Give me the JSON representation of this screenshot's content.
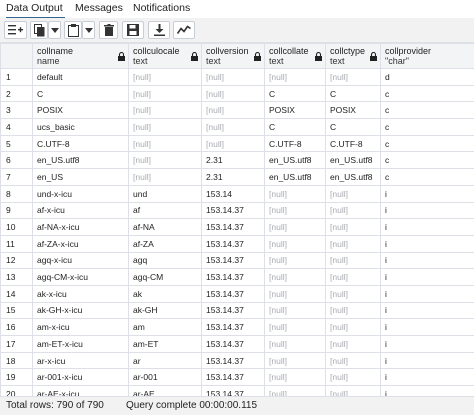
{
  "tabs": [
    {
      "label": "Data Output",
      "active": true
    },
    {
      "label": "Messages",
      "active": false
    },
    {
      "label": "Notifications",
      "active": false
    }
  ],
  "toolbar": {
    "buttons": [
      "add-row-icon",
      "copy-icon",
      "copy-dropdown-icon",
      "paste-icon",
      "paste-dropdown-icon",
      "delete-icon",
      "save-data-icon",
      "download-icon",
      "graph-icon"
    ]
  },
  "columns": [
    {
      "name": "",
      "type": ""
    },
    {
      "name": "collname",
      "type": "name"
    },
    {
      "name": "collculocale",
      "type": "text"
    },
    {
      "name": "collversion",
      "type": "text"
    },
    {
      "name": "collcollate",
      "type": "text"
    },
    {
      "name": "collctype",
      "type": "text"
    },
    {
      "name": "collprovider",
      "type": "\"char\""
    }
  ],
  "null_text": "[null]",
  "rows": [
    [
      "1",
      "default",
      "[null]",
      "[null]",
      "[null]",
      "[null]",
      "d"
    ],
    [
      "2",
      "C",
      "[null]",
      "[null]",
      "C",
      "C",
      "c"
    ],
    [
      "3",
      "POSIX",
      "[null]",
      "[null]",
      "POSIX",
      "POSIX",
      "c"
    ],
    [
      "4",
      "ucs_basic",
      "[null]",
      "[null]",
      "C",
      "C",
      "c"
    ],
    [
      "5",
      "C.UTF-8",
      "[null]",
      "[null]",
      "C.UTF-8",
      "C.UTF-8",
      "c"
    ],
    [
      "6",
      "en_US.utf8",
      "[null]",
      "2.31",
      "en_US.utf8",
      "en_US.utf8",
      "c"
    ],
    [
      "7",
      "en_US",
      "[null]",
      "2.31",
      "en_US.utf8",
      "en_US.utf8",
      "c"
    ],
    [
      "8",
      "und-x-icu",
      "und",
      "153.14",
      "[null]",
      "[null]",
      "i"
    ],
    [
      "9",
      "af-x-icu",
      "af",
      "153.14.37",
      "[null]",
      "[null]",
      "i"
    ],
    [
      "10",
      "af-NA-x-icu",
      "af-NA",
      "153.14.37",
      "[null]",
      "[null]",
      "i"
    ],
    [
      "11",
      "af-ZA-x-icu",
      "af-ZA",
      "153.14.37",
      "[null]",
      "[null]",
      "i"
    ],
    [
      "12",
      "agq-x-icu",
      "agq",
      "153.14.37",
      "[null]",
      "[null]",
      "i"
    ],
    [
      "13",
      "agq-CM-x-icu",
      "agq-CM",
      "153.14.37",
      "[null]",
      "[null]",
      "i"
    ],
    [
      "14",
      "ak-x-icu",
      "ak",
      "153.14.37",
      "[null]",
      "[null]",
      "i"
    ],
    [
      "15",
      "ak-GH-x-icu",
      "ak-GH",
      "153.14.37",
      "[null]",
      "[null]",
      "i"
    ],
    [
      "16",
      "am-x-icu",
      "am",
      "153.14.37",
      "[null]",
      "[null]",
      "i"
    ],
    [
      "17",
      "am-ET-x-icu",
      "am-ET",
      "153.14.37",
      "[null]",
      "[null]",
      "i"
    ],
    [
      "18",
      "ar-x-icu",
      "ar",
      "153.14.37",
      "[null]",
      "[null]",
      "i"
    ],
    [
      "19",
      "ar-001-x-icu",
      "ar-001",
      "153.14.37",
      "[null]",
      "[null]",
      "i"
    ],
    [
      "20",
      "ar-AE-x-icu",
      "ar-AE",
      "153.14.37",
      "[null]",
      "[null]",
      "i"
    ]
  ],
  "status": {
    "total_rows": "Total rows: 790 of 790",
    "query": "Query complete 00:00:00.115"
  }
}
